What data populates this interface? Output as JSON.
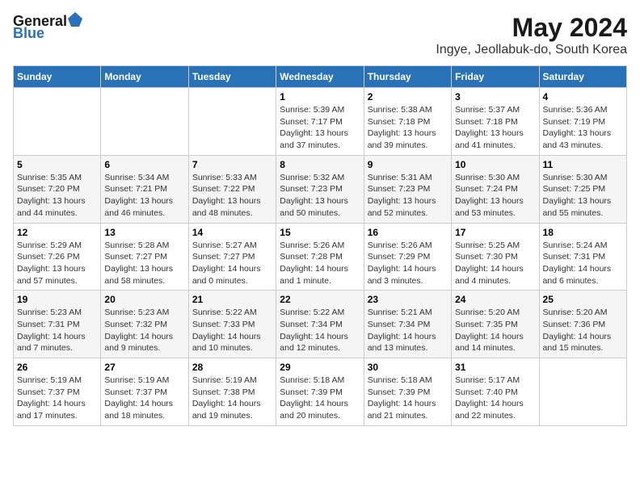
{
  "logo": {
    "general": "General",
    "blue": "Blue"
  },
  "title": "May 2024",
  "location": "Ingye, Jeollabuk-do, South Korea",
  "days_of_week": [
    "Sunday",
    "Monday",
    "Tuesday",
    "Wednesday",
    "Thursday",
    "Friday",
    "Saturday"
  ],
  "weeks": [
    [
      {
        "day": "",
        "info": ""
      },
      {
        "day": "",
        "info": ""
      },
      {
        "day": "",
        "info": ""
      },
      {
        "day": "1",
        "info": "Sunrise: 5:39 AM\nSunset: 7:17 PM\nDaylight: 13 hours\nand 37 minutes."
      },
      {
        "day": "2",
        "info": "Sunrise: 5:38 AM\nSunset: 7:18 PM\nDaylight: 13 hours\nand 39 minutes."
      },
      {
        "day": "3",
        "info": "Sunrise: 5:37 AM\nSunset: 7:18 PM\nDaylight: 13 hours\nand 41 minutes."
      },
      {
        "day": "4",
        "info": "Sunrise: 5:36 AM\nSunset: 7:19 PM\nDaylight: 13 hours\nand 43 minutes."
      }
    ],
    [
      {
        "day": "5",
        "info": "Sunrise: 5:35 AM\nSunset: 7:20 PM\nDaylight: 13 hours\nand 44 minutes."
      },
      {
        "day": "6",
        "info": "Sunrise: 5:34 AM\nSunset: 7:21 PM\nDaylight: 13 hours\nand 46 minutes."
      },
      {
        "day": "7",
        "info": "Sunrise: 5:33 AM\nSunset: 7:22 PM\nDaylight: 13 hours\nand 48 minutes."
      },
      {
        "day": "8",
        "info": "Sunrise: 5:32 AM\nSunset: 7:23 PM\nDaylight: 13 hours\nand 50 minutes."
      },
      {
        "day": "9",
        "info": "Sunrise: 5:31 AM\nSunset: 7:23 PM\nDaylight: 13 hours\nand 52 minutes."
      },
      {
        "day": "10",
        "info": "Sunrise: 5:30 AM\nSunset: 7:24 PM\nDaylight: 13 hours\nand 53 minutes."
      },
      {
        "day": "11",
        "info": "Sunrise: 5:30 AM\nSunset: 7:25 PM\nDaylight: 13 hours\nand 55 minutes."
      }
    ],
    [
      {
        "day": "12",
        "info": "Sunrise: 5:29 AM\nSunset: 7:26 PM\nDaylight: 13 hours\nand 57 minutes."
      },
      {
        "day": "13",
        "info": "Sunrise: 5:28 AM\nSunset: 7:27 PM\nDaylight: 13 hours\nand 58 minutes."
      },
      {
        "day": "14",
        "info": "Sunrise: 5:27 AM\nSunset: 7:27 PM\nDaylight: 14 hours\nand 0 minutes."
      },
      {
        "day": "15",
        "info": "Sunrise: 5:26 AM\nSunset: 7:28 PM\nDaylight: 14 hours\nand 1 minute."
      },
      {
        "day": "16",
        "info": "Sunrise: 5:26 AM\nSunset: 7:29 PM\nDaylight: 14 hours\nand 3 minutes."
      },
      {
        "day": "17",
        "info": "Sunrise: 5:25 AM\nSunset: 7:30 PM\nDaylight: 14 hours\nand 4 minutes."
      },
      {
        "day": "18",
        "info": "Sunrise: 5:24 AM\nSunset: 7:31 PM\nDaylight: 14 hours\nand 6 minutes."
      }
    ],
    [
      {
        "day": "19",
        "info": "Sunrise: 5:23 AM\nSunset: 7:31 PM\nDaylight: 14 hours\nand 7 minutes."
      },
      {
        "day": "20",
        "info": "Sunrise: 5:23 AM\nSunset: 7:32 PM\nDaylight: 14 hours\nand 9 minutes."
      },
      {
        "day": "21",
        "info": "Sunrise: 5:22 AM\nSunset: 7:33 PM\nDaylight: 14 hours\nand 10 minutes."
      },
      {
        "day": "22",
        "info": "Sunrise: 5:22 AM\nSunset: 7:34 PM\nDaylight: 14 hours\nand 12 minutes."
      },
      {
        "day": "23",
        "info": "Sunrise: 5:21 AM\nSunset: 7:34 PM\nDaylight: 14 hours\nand 13 minutes."
      },
      {
        "day": "24",
        "info": "Sunrise: 5:20 AM\nSunset: 7:35 PM\nDaylight: 14 hours\nand 14 minutes."
      },
      {
        "day": "25",
        "info": "Sunrise: 5:20 AM\nSunset: 7:36 PM\nDaylight: 14 hours\nand 15 minutes."
      }
    ],
    [
      {
        "day": "26",
        "info": "Sunrise: 5:19 AM\nSunset: 7:37 PM\nDaylight: 14 hours\nand 17 minutes."
      },
      {
        "day": "27",
        "info": "Sunrise: 5:19 AM\nSunset: 7:37 PM\nDaylight: 14 hours\nand 18 minutes."
      },
      {
        "day": "28",
        "info": "Sunrise: 5:19 AM\nSunset: 7:38 PM\nDaylight: 14 hours\nand 19 minutes."
      },
      {
        "day": "29",
        "info": "Sunrise: 5:18 AM\nSunset: 7:39 PM\nDaylight: 14 hours\nand 20 minutes."
      },
      {
        "day": "30",
        "info": "Sunrise: 5:18 AM\nSunset: 7:39 PM\nDaylight: 14 hours\nand 21 minutes."
      },
      {
        "day": "31",
        "info": "Sunrise: 5:17 AM\nSunset: 7:40 PM\nDaylight: 14 hours\nand 22 minutes."
      },
      {
        "day": "",
        "info": ""
      }
    ]
  ]
}
